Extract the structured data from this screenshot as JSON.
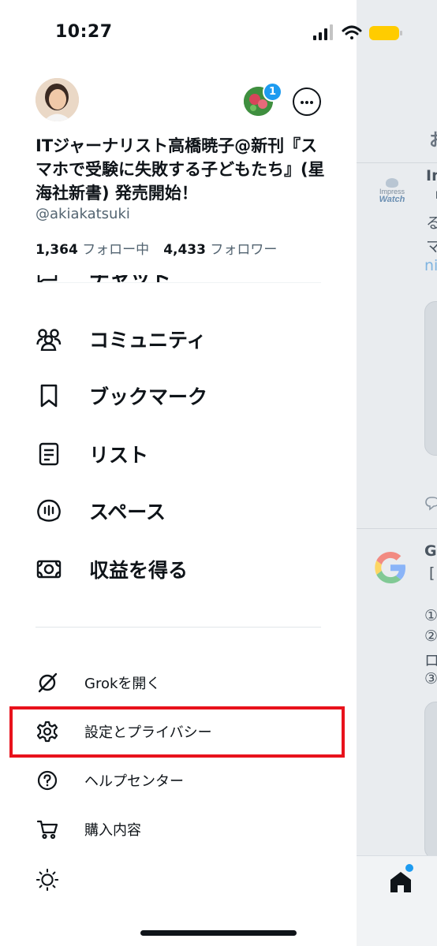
{
  "status_bar": {
    "time": "10:27"
  },
  "profile": {
    "display_name": "ITジャーナリスト高橋暁子@新刊『スマホで受験に失敗する子どもたち』(星海社新書) 発売開始！",
    "handle": "@akiakatsuki",
    "following_count": "1,364",
    "following_label": "フォロー中",
    "followers_count": "4,433",
    "followers_label": "フォロワー",
    "account_badge_count": "1"
  },
  "menu": {
    "cut_item": "チャット",
    "items": [
      {
        "label": "コミュニティ",
        "icon": "communities-icon"
      },
      {
        "label": "ブックマーク",
        "icon": "bookmark-icon"
      },
      {
        "label": "リスト",
        "icon": "list-icon"
      },
      {
        "label": "スペース",
        "icon": "spaces-icon"
      },
      {
        "label": "収益を得る",
        "icon": "monetization-icon"
      }
    ],
    "sub_items": [
      {
        "label": "Grokを開く",
        "icon": "grok-icon"
      },
      {
        "label": "設定とプライバシー",
        "icon": "gear-icon",
        "highlighted": true
      },
      {
        "label": "ヘルプセンター",
        "icon": "help-icon"
      },
      {
        "label": "購入内容",
        "icon": "cart-icon"
      }
    ],
    "theme_icon": "sun-icon"
  },
  "timeline": {
    "tab_label": "お",
    "post1": {
      "source": "Impress",
      "source2": "Watch",
      "author": "In",
      "line1": "「",
      "line2": "る",
      "line3": "マ",
      "link": "ni"
    },
    "post2": {
      "author": "G",
      "line1": "[",
      "item1": "①",
      "item2": "②",
      "item3": "ロ",
      "item4": "③"
    }
  },
  "colors": {
    "highlight": "#e8121c",
    "accent": "#1d9bf0",
    "battery": "#ffcc00"
  }
}
